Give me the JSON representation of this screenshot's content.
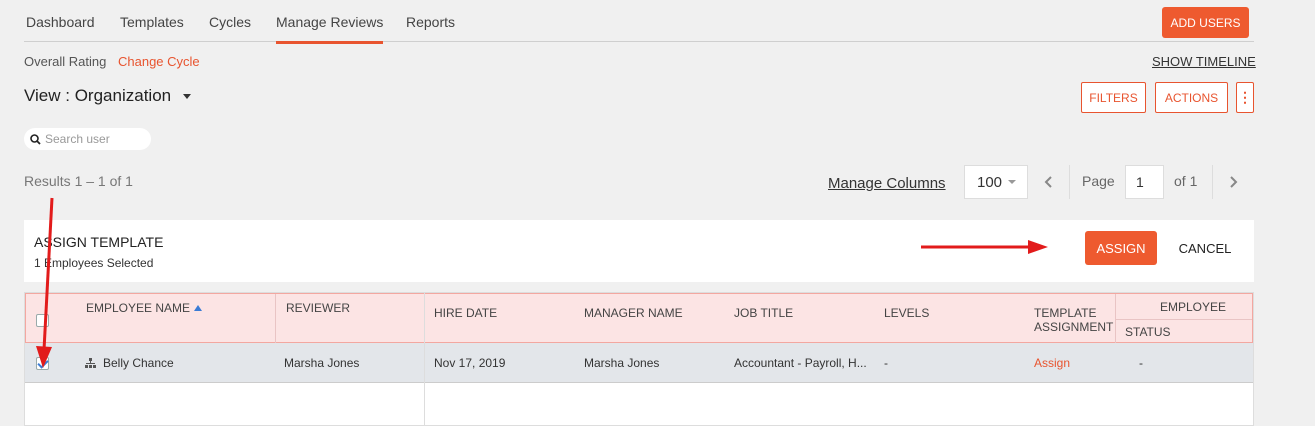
{
  "nav": {
    "tabs": [
      "Dashboard",
      "Templates",
      "Cycles",
      "Manage Reviews",
      "Reports"
    ],
    "active_tab": "Manage Reviews",
    "add_users_label": "ADD USERS"
  },
  "subnav": {
    "overall_rating": "Overall Rating",
    "change_cycle": "Change Cycle",
    "show_timeline": "SHOW TIMELINE"
  },
  "view": {
    "label": "View : Organization"
  },
  "actions": {
    "filters_label": "FILTERS",
    "actions_label": "ACTIONS",
    "more_glyph": "⋮"
  },
  "search": {
    "placeholder": "Search user"
  },
  "results": {
    "text": "Results 1 – 1 of 1"
  },
  "pagination": {
    "manage_columns": "Manage Columns",
    "per_page": "100",
    "page_label": "Page",
    "page_value": "1",
    "of_label": "of 1"
  },
  "assign_panel": {
    "title": "ASSIGN TEMPLATE",
    "subtitle": "1 Employees Selected",
    "assign_label": "ASSIGN",
    "cancel_label": "CANCEL"
  },
  "table": {
    "headers": {
      "employee_name": "EMPLOYEE NAME",
      "reviewer": "REVIEWER",
      "hire_date": "HIRE DATE",
      "manager_name": "MANAGER NAME",
      "job_title": "JOB TITLE",
      "levels": "LEVELS",
      "template_assignment_1": "TEMPLATE",
      "template_assignment_2": "ASSIGNMENT",
      "employee_status_1": "EMPLOYEE",
      "employee_status_2": "STATUS"
    },
    "rows": [
      {
        "selected": true,
        "employee_name": "Belly Chance",
        "reviewer": "Marsha Jones",
        "hire_date": "Nov 17, 2019",
        "manager_name": "Marsha Jones",
        "job_title": "Accountant - Payroll, H...",
        "levels": "-",
        "template_assignment": "Assign",
        "employee_status": "-"
      }
    ]
  },
  "colors": {
    "accent": "#e8542f",
    "header_bg": "#fce4e4",
    "row_selected_bg": "#e3e6ea",
    "annotation_arrow": "#e21b1b"
  },
  "icons": {
    "search": "search-icon",
    "org": "org-chart-icon",
    "prev": "chevron-left-icon",
    "next": "chevron-right-icon"
  }
}
